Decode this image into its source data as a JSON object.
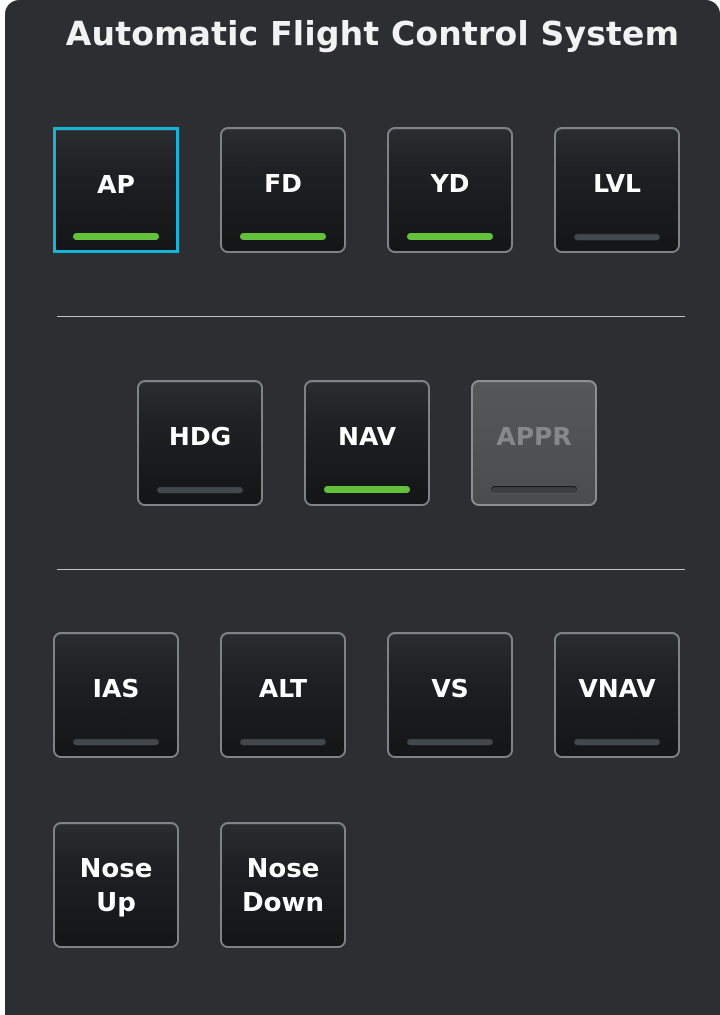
{
  "title": "Automatic Flight Control System",
  "colors": {
    "panel_bg": "#2c2e31",
    "selected_border": "#17b3d9",
    "indicator_on": "#63c13b",
    "indicator_off": "#43484c"
  },
  "buttons": {
    "ap": {
      "label": "AP",
      "indicator": "on",
      "state": "selected"
    },
    "fd": {
      "label": "FD",
      "indicator": "on",
      "state": "normal"
    },
    "yd": {
      "label": "YD",
      "indicator": "on",
      "state": "normal"
    },
    "lvl": {
      "label": "LVL",
      "indicator": "off",
      "state": "normal"
    },
    "hdg": {
      "label": "HDG",
      "indicator": "off",
      "state": "normal"
    },
    "nav": {
      "label": "NAV",
      "indicator": "on",
      "state": "normal"
    },
    "appr": {
      "label": "APPR",
      "indicator": "off",
      "state": "disabled"
    },
    "ias": {
      "label": "IAS",
      "indicator": "off",
      "state": "normal"
    },
    "alt": {
      "label": "ALT",
      "indicator": "off",
      "state": "normal"
    },
    "vs": {
      "label": "VS",
      "indicator": "off",
      "state": "normal"
    },
    "vnav": {
      "label": "VNAV",
      "indicator": "off",
      "state": "normal"
    },
    "nose_up": {
      "line1": "Nose",
      "line2": "Up"
    },
    "nose_down": {
      "line1": "Nose",
      "line2": "Down"
    }
  }
}
